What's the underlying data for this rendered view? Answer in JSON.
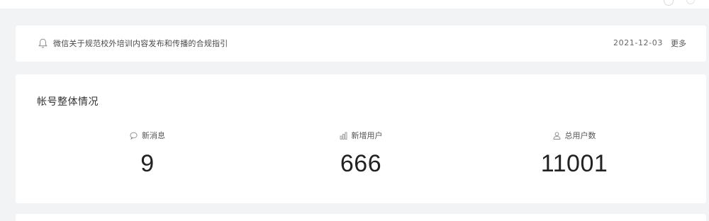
{
  "notice": {
    "icon": "bell-icon",
    "text": "微信关于规范校外培训内容发布和传播的合规指引",
    "date": "2021-12-03",
    "more_label": "更多"
  },
  "stats": {
    "title": "帐号整体情况",
    "items": [
      {
        "label": "新消息",
        "value": "9",
        "icon": "message-icon"
      },
      {
        "label": "新增用户",
        "value": "666",
        "icon": "bar-chart-icon"
      },
      {
        "label": "总用户数",
        "value": "11001",
        "icon": "user-icon"
      }
    ]
  }
}
